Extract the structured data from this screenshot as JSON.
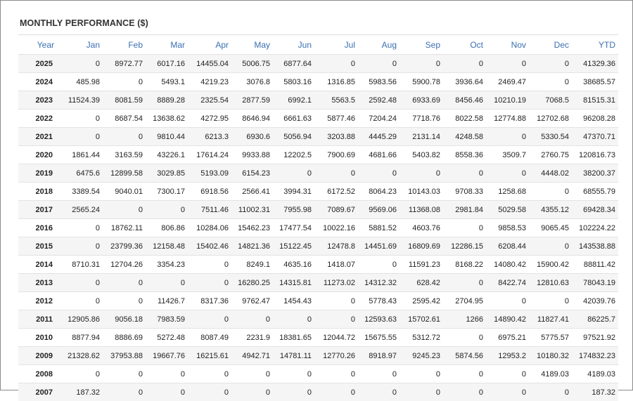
{
  "title": "MONTHLY PERFORMANCE ($)",
  "columns": [
    "Year",
    "Jan",
    "Feb",
    "Mar",
    "Apr",
    "May",
    "Jun",
    "Jul",
    "Aug",
    "Sep",
    "Oct",
    "Nov",
    "Dec",
    "YTD"
  ],
  "colors": {
    "header_text": "#3a6fb0",
    "stripe": "#f5f5f5",
    "border": "#8a8a8a"
  },
  "rows": [
    [
      "2025",
      "0",
      "8972.77",
      "6017.16",
      "14455.04",
      "5006.75",
      "6877.64",
      "0",
      "0",
      "0",
      "0",
      "0",
      "0",
      "41329.36"
    ],
    [
      "2024",
      "485.98",
      "0",
      "5493.1",
      "4219.23",
      "3076.8",
      "5803.16",
      "1316.85",
      "5983.56",
      "5900.78",
      "3936.64",
      "2469.47",
      "0",
      "38685.57"
    ],
    [
      "2023",
      "11524.39",
      "8081.59",
      "8889.28",
      "2325.54",
      "2877.59",
      "6992.1",
      "5563.5",
      "2592.48",
      "6933.69",
      "8456.46",
      "10210.19",
      "7068.5",
      "81515.31"
    ],
    [
      "2022",
      "0",
      "8687.54",
      "13638.62",
      "4272.95",
      "8646.94",
      "6661.63",
      "5877.46",
      "7204.24",
      "7718.76",
      "8022.58",
      "12774.88",
      "12702.68",
      "96208.28"
    ],
    [
      "2021",
      "0",
      "0",
      "9810.44",
      "6213.3",
      "6930.6",
      "5056.94",
      "3203.88",
      "4445.29",
      "2131.14",
      "4248.58",
      "0",
      "5330.54",
      "47370.71"
    ],
    [
      "2020",
      "1861.44",
      "3163.59",
      "43226.1",
      "17614.24",
      "9933.88",
      "12202.5",
      "7900.69",
      "4681.66",
      "5403.82",
      "8558.36",
      "3509.7",
      "2760.75",
      "120816.73"
    ],
    [
      "2019",
      "6475.6",
      "12899.58",
      "3029.85",
      "5193.09",
      "6154.23",
      "0",
      "0",
      "0",
      "0",
      "0",
      "0",
      "4448.02",
      "38200.37"
    ],
    [
      "2018",
      "3389.54",
      "9040.01",
      "7300.17",
      "6918.56",
      "2566.41",
      "3994.31",
      "6172.52",
      "8064.23",
      "10143.03",
      "9708.33",
      "1258.68",
      "0",
      "68555.79"
    ],
    [
      "2017",
      "2565.24",
      "0",
      "0",
      "7511.46",
      "11002.31",
      "7955.98",
      "7089.67",
      "9569.06",
      "11368.08",
      "2981.84",
      "5029.58",
      "4355.12",
      "69428.34"
    ],
    [
      "2016",
      "0",
      "18762.11",
      "806.86",
      "10284.06",
      "15462.23",
      "17477.54",
      "10022.16",
      "5881.52",
      "4603.76",
      "0",
      "9858.53",
      "9065.45",
      "102224.22"
    ],
    [
      "2015",
      "0",
      "23799.36",
      "12158.48",
      "15402.46",
      "14821.36",
      "15122.45",
      "12478.8",
      "14451.69",
      "16809.69",
      "12286.15",
      "6208.44",
      "0",
      "143538.88"
    ],
    [
      "2014",
      "8710.31",
      "12704.26",
      "3354.23",
      "0",
      "8249.1",
      "4635.16",
      "1418.07",
      "0",
      "11591.23",
      "8168.22",
      "14080.42",
      "15900.42",
      "88811.42"
    ],
    [
      "2013",
      "0",
      "0",
      "0",
      "0",
      "16280.25",
      "14315.81",
      "11273.02",
      "14312.32",
      "628.42",
      "0",
      "8422.74",
      "12810.63",
      "78043.19"
    ],
    [
      "2012",
      "0",
      "0",
      "11426.7",
      "8317.36",
      "9762.47",
      "1454.43",
      "0",
      "5778.43",
      "2595.42",
      "2704.95",
      "0",
      "0",
      "42039.76"
    ],
    [
      "2011",
      "12905.86",
      "9056.18",
      "7983.59",
      "0",
      "0",
      "0",
      "0",
      "12593.63",
      "15702.61",
      "1266",
      "14890.42",
      "11827.41",
      "86225.7"
    ],
    [
      "2010",
      "8877.94",
      "8886.69",
      "5272.48",
      "8087.49",
      "2231.9",
      "18381.65",
      "12044.72",
      "15675.55",
      "5312.72",
      "0",
      "6975.21",
      "5775.57",
      "97521.92"
    ],
    [
      "2009",
      "21328.62",
      "37953.88",
      "19667.76",
      "16215.61",
      "4942.71",
      "14781.11",
      "12770.26",
      "8918.97",
      "9245.23",
      "5874.56",
      "12953.2",
      "10180.32",
      "174832.23"
    ],
    [
      "2008",
      "0",
      "0",
      "0",
      "0",
      "0",
      "0",
      "0",
      "0",
      "0",
      "0",
      "0",
      "4189.03",
      "4189.03"
    ],
    [
      "2007",
      "187.32",
      "0",
      "0",
      "0",
      "0",
      "0",
      "0",
      "0",
      "0",
      "0",
      "0",
      "0",
      "187.32"
    ]
  ]
}
